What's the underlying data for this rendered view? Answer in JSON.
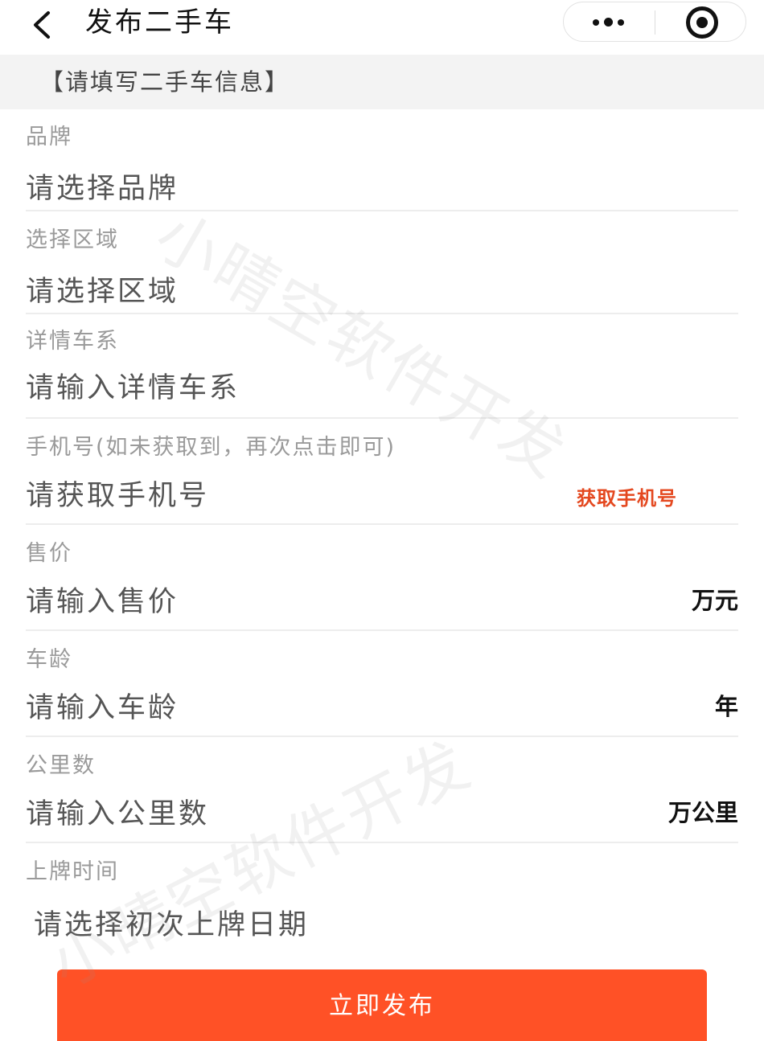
{
  "nav": {
    "title": "发布二手车"
  },
  "section": {
    "title": "【请填写二手车信息】"
  },
  "fields": {
    "brand": {
      "label": "品牌",
      "placeholder": "请选择品牌"
    },
    "region": {
      "label": "选择区域",
      "placeholder": "请选择区域"
    },
    "series": {
      "label": "详情车系",
      "placeholder": "请输入详情车系"
    },
    "phone": {
      "label": "手机号(如未获取到，再次点击即可)",
      "placeholder": "请获取手机号",
      "action": "获取手机号"
    },
    "price": {
      "label": "售价",
      "placeholder": "请输入售价",
      "unit": "万元"
    },
    "age": {
      "label": "车龄",
      "placeholder": "请输入车龄",
      "unit": "年"
    },
    "mileage": {
      "label": "公里数",
      "placeholder": "请输入公里数",
      "unit": "万公里"
    },
    "register": {
      "label": "上牌时间",
      "placeholder": "请选择初次上牌日期"
    }
  },
  "submit": {
    "label": "立即发布"
  },
  "watermark": {
    "text": "小晴空软件开发"
  },
  "colors": {
    "accent": "#ff5126",
    "action_text": "#e4481f"
  }
}
